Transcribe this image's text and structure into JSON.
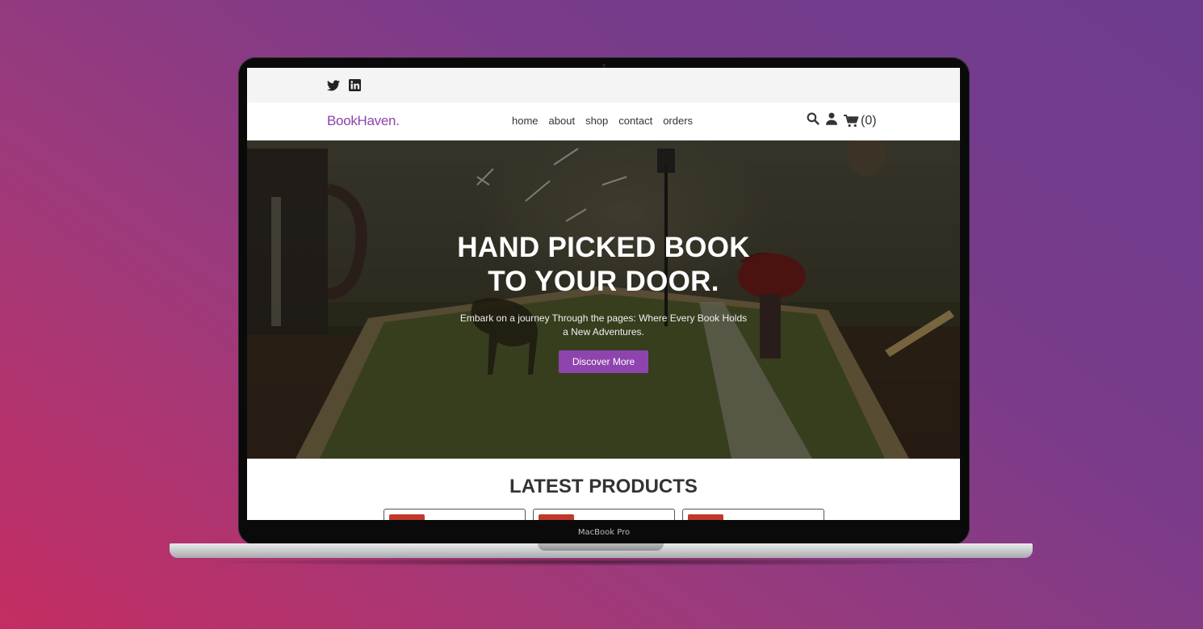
{
  "device": {
    "label": "MacBook Pro"
  },
  "site": {
    "topbar": {
      "social_icons": [
        "twitter-icon",
        "linkedin-icon"
      ]
    },
    "logo": "BookHaven.",
    "nav": [
      "home",
      "about",
      "shop",
      "contact",
      "orders"
    ],
    "icons": [
      "search-icon",
      "user-icon",
      "cart-icon"
    ],
    "cart_count": "(0)",
    "hero": {
      "title_line1": "HAND PICKED BOOK",
      "title_line2": "TO YOUR DOOR.",
      "subtitle": "Embark on a journey Through the pages: Where Every Book Holds a New Adventures.",
      "button": "Discover More"
    },
    "latest": {
      "title": "LATEST PRODUCTS"
    },
    "colors": {
      "accent": "#8e44ad",
      "badge": "#c0392b",
      "topbar": "#f4f4f4"
    }
  }
}
